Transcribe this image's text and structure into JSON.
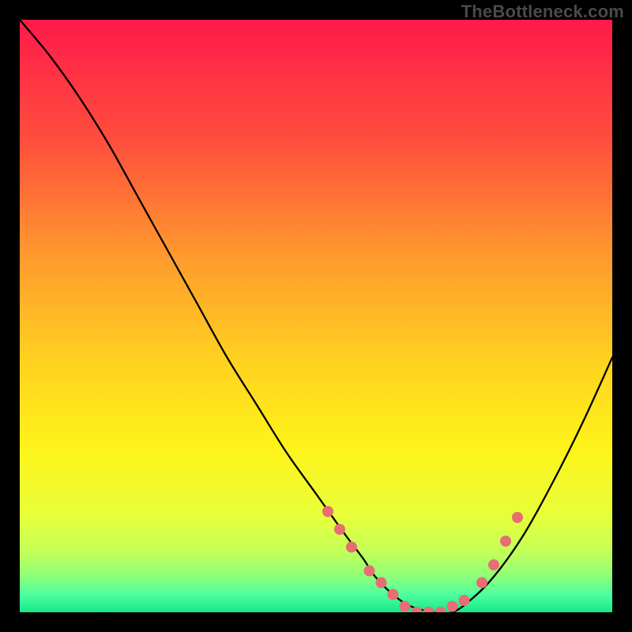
{
  "watermark": "TheBottleneck.com",
  "chart_data": {
    "type": "line",
    "title": "",
    "xlabel": "",
    "ylabel": "",
    "xlim": [
      0,
      100
    ],
    "ylim": [
      0,
      100
    ],
    "series": [
      {
        "name": "bottleneck-curve",
        "x": [
          0,
          5,
          10,
          15,
          20,
          25,
          30,
          35,
          40,
          45,
          50,
          55,
          58,
          60,
          63,
          66,
          70,
          73,
          76,
          80,
          85,
          90,
          95,
          100
        ],
        "y": [
          100,
          94,
          87,
          79,
          70,
          61,
          52,
          43,
          35,
          27,
          20,
          13,
          9,
          6,
          3,
          1,
          0,
          0,
          2,
          6,
          13,
          22,
          32,
          43
        ]
      }
    ],
    "markers": {
      "name": "highlight-dots",
      "x": [
        52,
        54,
        56,
        59,
        61,
        63,
        65,
        67,
        69,
        71,
        73,
        75,
        78,
        80,
        82,
        84
      ],
      "y": [
        17,
        14,
        11,
        7,
        5,
        3,
        1,
        0,
        0,
        0,
        1,
        2,
        5,
        8,
        12,
        16
      ]
    },
    "gradient_stops": [
      {
        "pct": 0,
        "color": "#ff1a4b"
      },
      {
        "pct": 20,
        "color": "#ff4d3d"
      },
      {
        "pct": 40,
        "color": "#ff9a2e"
      },
      {
        "pct": 58,
        "color": "#ffd31f"
      },
      {
        "pct": 72,
        "color": "#fff31a"
      },
      {
        "pct": 84,
        "color": "#e7ff3a"
      },
      {
        "pct": 90,
        "color": "#c1ff5a"
      },
      {
        "pct": 94,
        "color": "#8dff7a"
      },
      {
        "pct": 97,
        "color": "#4dffa0"
      },
      {
        "pct": 100,
        "color": "#17e88a"
      }
    ]
  }
}
